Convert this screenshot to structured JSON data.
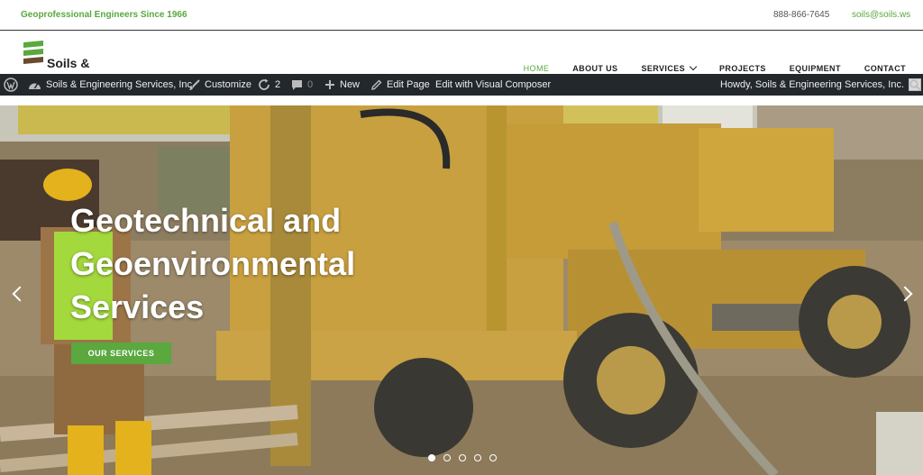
{
  "topbar": {
    "tagline": "Geoprofessional Engineers Since 1966",
    "phone": "888-866-7645",
    "email": "soils@soils.ws"
  },
  "header": {
    "logo_text": "Soils &",
    "nav": [
      "HOME",
      "ABOUT US",
      "SERVICES",
      "PROJECTS",
      "EQUIPMENT",
      "CONTACT"
    ],
    "active_nav": "HOME"
  },
  "adminbar": {
    "site_name": "Soils & Engineering Services, Inc.",
    "customize": "Customize",
    "updates_count": "2",
    "comments_count": "0",
    "new": "New",
    "edit_page": "Edit Page",
    "edit_visual": "Edit with Visual Composer",
    "howdy": "Howdy, Soils & Engineering Services, Inc."
  },
  "hero": {
    "headline_lines": [
      "Geotechnical and",
      "Geoenvironmental",
      "Services"
    ],
    "cta": "OUR SERVICES",
    "slide_count": 5,
    "active_slide": 1
  },
  "colors": {
    "brand_green": "#5aa83e",
    "admin_bar": "#23282d",
    "rig_yellow": "#c9a23a"
  },
  "icons": [
    "wordpress-icon",
    "dashboard-icon",
    "brush-icon",
    "refresh-icon",
    "comment-icon",
    "plus-icon",
    "pencil-icon",
    "search-icon",
    "chevron-left-icon",
    "chevron-right-icon"
  ]
}
